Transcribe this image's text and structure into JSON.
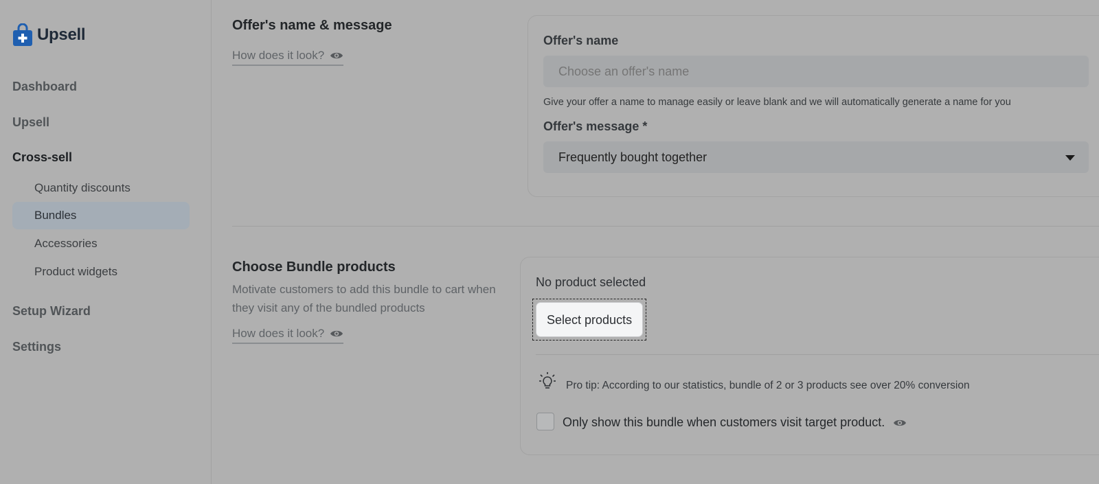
{
  "app": {
    "name": "Upsell"
  },
  "sidebar": {
    "items": [
      {
        "label": "Dashboard"
      },
      {
        "label": "Upsell"
      },
      {
        "label": "Cross-sell"
      },
      {
        "label": "Setup Wizard"
      },
      {
        "label": "Settings"
      }
    ],
    "cross_sell_sub": [
      {
        "label": "Quantity discounts"
      },
      {
        "label": "Bundles"
      },
      {
        "label": "Accessories"
      },
      {
        "label": "Product widgets"
      }
    ]
  },
  "offer_section": {
    "title": "Offer's name & message",
    "how_link": "How does it look?",
    "name_label": "Offer's name",
    "name_placeholder": "Choose an offer's name",
    "name_helper": "Give your offer a name to manage easily or leave blank and we will automatically generate a name for you",
    "message_label": "Offer's message *",
    "message_value": "Frequently bought together"
  },
  "bundle_section": {
    "title": "Choose Bundle products",
    "description": "Motivate customers to add this bundle to cart when they visit any of the bundled products",
    "how_link": "How does it look?",
    "no_product": "No product selected",
    "select_button": "Select products",
    "pro_tip": "Pro tip: According to our statistics, bundle of 2 or 3 products see over 20% conversion",
    "checkbox_label": "Only show this bundle when customers visit target product.",
    "checkbox_checked": false
  },
  "colors": {
    "brand": "#1f5fb0",
    "background": "#b0b0b0"
  }
}
